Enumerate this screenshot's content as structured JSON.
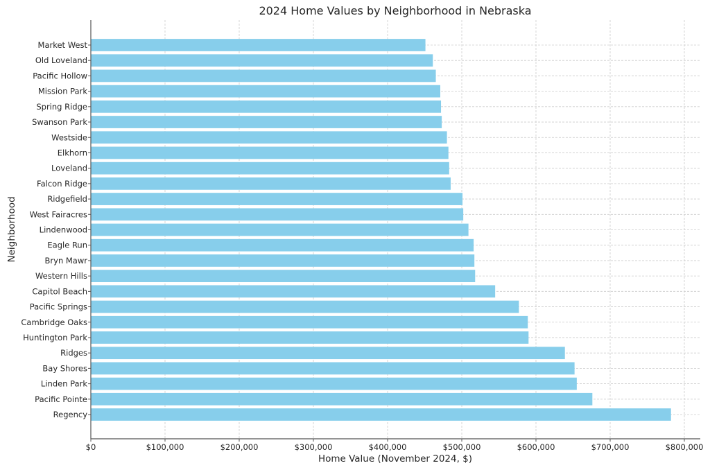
{
  "chart_data": {
    "type": "bar",
    "orientation": "horizontal",
    "title": "2024 Home Values by Neighborhood in Nebraska",
    "xlabel": "Home Value (November 2024, $)",
    "ylabel": "Neighborhood",
    "xlim": [
      0,
      820000
    ],
    "xticks": [
      0,
      100000,
      200000,
      300000,
      400000,
      500000,
      600000,
      700000,
      800000
    ],
    "xtick_labels": [
      "$0",
      "$100,000",
      "$200,000",
      "$300,000",
      "$400,000",
      "$500,000",
      "$600,000",
      "$700,000",
      "$800,000"
    ],
    "grid": true,
    "bar_color": "#87ceeb",
    "categories": [
      "Market West",
      "Old Loveland",
      "Pacific Hollow",
      "Mission Park",
      "Spring Ridge",
      "Swanson Park",
      "Westside",
      "Elkhorn",
      "Loveland",
      "Falcon Ridge",
      "Ridgefield",
      "West Fairacres",
      "Lindenwood",
      "Eagle Run",
      "Bryn Mawr",
      "Western Hills",
      "Capitol Beach",
      "Pacific Springs",
      "Cambridge Oaks",
      "Huntington Park",
      "Ridges",
      "Bay Shores",
      "Linden Park",
      "Pacific Pointe",
      "Regency"
    ],
    "values": [
      451000,
      461000,
      465000,
      471000,
      472000,
      473000,
      480000,
      482000,
      483000,
      485000,
      501000,
      502000,
      509000,
      516000,
      517000,
      518000,
      545000,
      577000,
      589000,
      590000,
      639000,
      652000,
      655000,
      676000,
      782000
    ]
  }
}
